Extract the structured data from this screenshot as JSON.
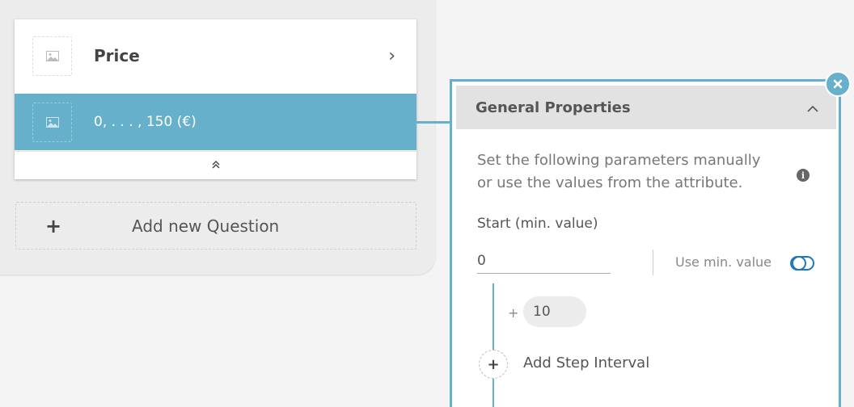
{
  "question_list": {
    "items": [
      {
        "label": "Price",
        "icon": "image-placeholder-icon",
        "chevron": "chevron-right-icon"
      },
      {
        "label": "0, . . . , 150 (€)",
        "icon": "image-placeholder-icon"
      }
    ],
    "collapse_icon": "double-chevron-up-icon",
    "add_question_label": "Add new Question"
  },
  "properties": {
    "header_title": "General Properties",
    "description": "Set the following parameters manually or use the values from the attribute.",
    "start_label": "Start (min. value)",
    "start_value": "0",
    "use_min_label": "Use min. value",
    "step_prefix": "+",
    "step_value": "10",
    "add_step_label": "Add Step Interval"
  },
  "colors": {
    "accent": "#66b0cb",
    "toggle": "#1c78b8",
    "header_bg": "#e2e2e2"
  }
}
